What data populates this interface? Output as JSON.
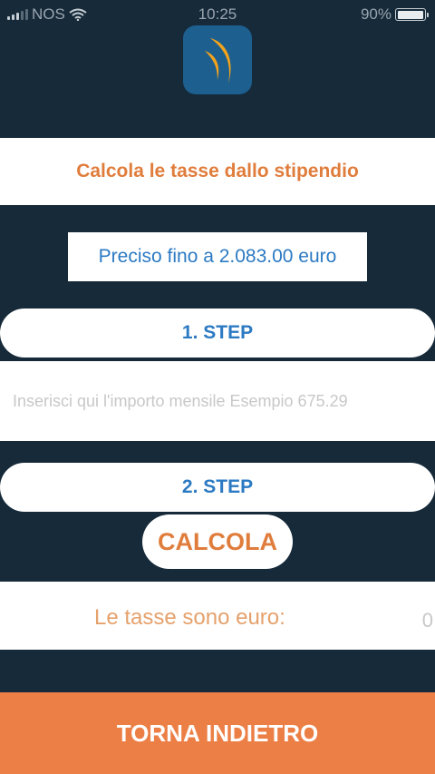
{
  "status_bar": {
    "carrier": "NOS",
    "time": "10:25",
    "battery": "90%",
    "battery_level": 0.9
  },
  "app": {
    "logo_icon": "swoosh-logo-icon",
    "title": "Calcola le tasse dallo stipendio",
    "precision_note": "Preciso fino a 2.083.00 euro"
  },
  "form": {
    "step1_label": "1. STEP",
    "amount_placeholder": "Inserisci qui l'importo mensile Esempio 675.29",
    "amount_value": "",
    "step2_label": "2. STEP",
    "calculate_label": "CALCOLA"
  },
  "result": {
    "label": "Le tasse sono euro:",
    "value": "0"
  },
  "footer": {
    "back_label": "TORNA INDIETRO"
  },
  "colors": {
    "background": "#162a3a",
    "accent_orange": "#e07d3c",
    "accent_blue": "#2c7ac3",
    "button_orange": "#ec7f46"
  }
}
